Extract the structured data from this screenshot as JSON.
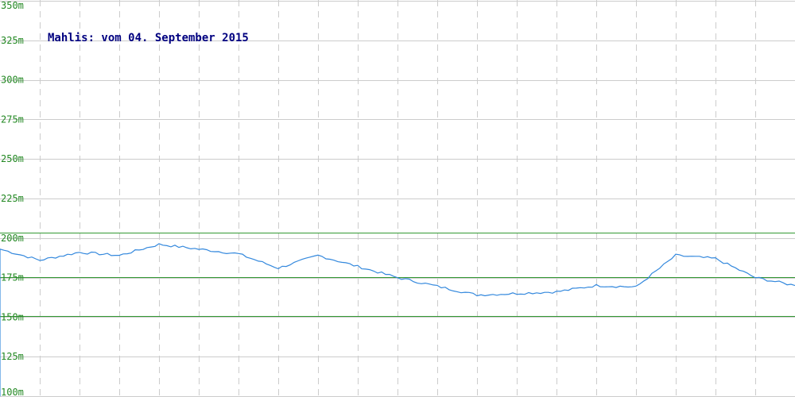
{
  "chart_data": {
    "type": "line",
    "title": "Mahlis: vom 04. September 2015",
    "xlabel": "",
    "ylabel": "",
    "ylim": [
      100,
      350
    ],
    "yticks": [
      {
        "value": 350,
        "label": "350m"
      },
      {
        "value": 325,
        "label": "325m"
      },
      {
        "value": 300,
        "label": "300m"
      },
      {
        "value": 275,
        "label": "275m"
      },
      {
        "value": 250,
        "label": "250m"
      },
      {
        "value": 225,
        "label": "225m"
      },
      {
        "value": 200,
        "label": "200m"
      },
      {
        "value": 175,
        "label": "175m"
      },
      {
        "value": 150,
        "label": "150m"
      },
      {
        "value": 125,
        "label": "125m"
      },
      {
        "value": 100,
        "label": "100m"
      }
    ],
    "x_divisions": 20,
    "grid": true,
    "reference_lines": [
      {
        "value": 203.5,
        "color": "#339933"
      },
      {
        "value": 175.5,
        "color": "#339933"
      },
      {
        "value": 150.5,
        "color": "#339933"
      }
    ],
    "series": [
      {
        "color": "#3388dd",
        "x": [
          0,
          1,
          2,
          3,
          4,
          6,
          7,
          8,
          10,
          12,
          14,
          15,
          16,
          17,
          18,
          19,
          20
        ],
        "values": [
          193,
          186,
          191,
          189,
          196,
          190,
          181,
          189,
          175,
          164,
          166,
          170,
          169,
          189,
          187,
          175,
          170
        ]
      }
    ]
  }
}
